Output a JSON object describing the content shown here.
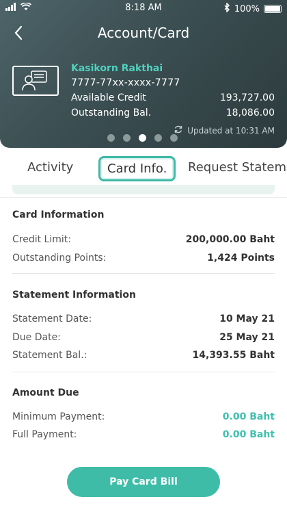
{
  "status_bar": {
    "time": "8:18 AM",
    "battery": "100%"
  },
  "nav": {
    "title": "Account/Card"
  },
  "card": {
    "name": "Kasikorn Rakthai",
    "number": "7777-77xx-xxxx-7777",
    "available_credit_label": "Available Credit",
    "available_credit_value": "193,727.00",
    "outstanding_label": "Outstanding Bal.",
    "outstanding_value": "18,086.00",
    "updated": "Updated at 10:31 AM",
    "pager": {
      "count": 5,
      "active_index": 2
    }
  },
  "tabs": [
    {
      "label": "Activity"
    },
    {
      "label": "Card Info.",
      "active": true
    },
    {
      "label": "Request Stateme"
    }
  ],
  "card_information": {
    "title": "Card Information",
    "rows": [
      {
        "label": "Credit Limit:",
        "value": "200,000.00 Baht"
      },
      {
        "label": "Outstanding Points:",
        "value": "1,424 Points"
      }
    ]
  },
  "statement_information": {
    "title": "Statement Information",
    "rows": [
      {
        "label": "Statement Date:",
        "value": "10 May 21"
      },
      {
        "label": "Due Date:",
        "value": "25 May 21"
      },
      {
        "label": "Statement Bal.:",
        "value": "14,393.55 Baht"
      }
    ]
  },
  "amount_due": {
    "title": "Amount Due",
    "rows": [
      {
        "label": "Minimum Payment:",
        "value": "0.00 Baht"
      },
      {
        "label": "Full Payment:",
        "value": "0.00 Baht"
      }
    ]
  },
  "pay_button": {
    "label": "Pay Card Bill"
  },
  "colors": {
    "accent": "#3fbca8",
    "header_bg": "#3b4e52",
    "name_teal": "#4fd1bd"
  },
  "icons": [
    "signal-icon",
    "wifi-icon",
    "bluetooth-icon",
    "battery-icon",
    "back-chevron-icon",
    "card-holder-icon",
    "refresh-icon"
  ]
}
